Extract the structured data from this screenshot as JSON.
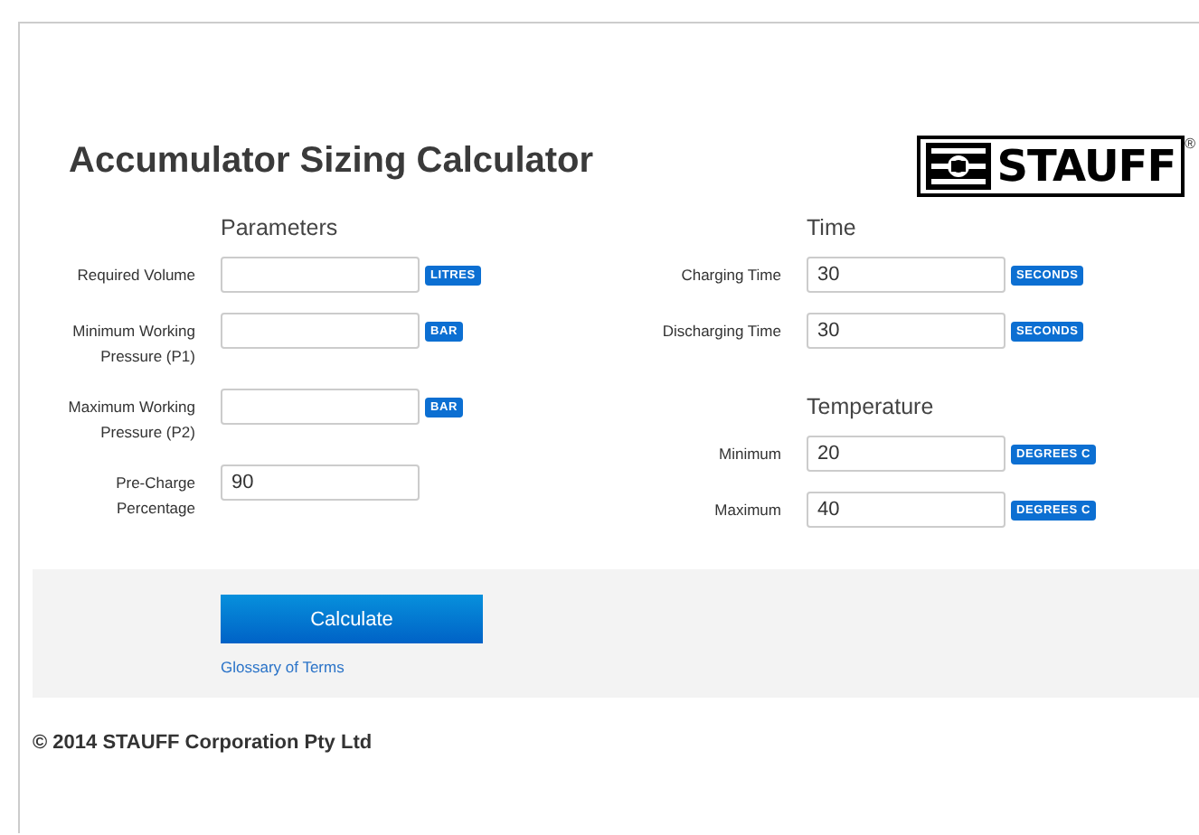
{
  "title": "Accumulator Sizing Calculator",
  "logo": {
    "text": "STAUFF",
    "mark": "®"
  },
  "left_column": [
    {
      "heading": "Parameters",
      "fields": [
        {
          "label": "Required Volume",
          "unit": "LITRES"
        },
        {
          "label": "Minimum Working Pressure (P1)",
          "unit": "BAR"
        },
        {
          "label": "Maximum Working Pressure (P2)",
          "unit": "BAR"
        },
        {
          "label": "Pre-Charge Percentage",
          "value": "90"
        }
      ]
    }
  ],
  "right_column": [
    {
      "heading": "Time",
      "fields": [
        {
          "label": "Charging Time",
          "value": "30",
          "unit": "SECONDS"
        },
        {
          "label": "Discharging Time",
          "value": "30",
          "unit": "SECONDS"
        }
      ]
    },
    {
      "heading": "Temperature",
      "fields": [
        {
          "label": "Minimum",
          "value": "20",
          "unit": "DEGREES C"
        },
        {
          "label": "Maximum",
          "value": "40",
          "unit": "DEGREES C"
        }
      ]
    }
  ],
  "button": "Calculate",
  "link": "Glossary of Terms",
  "footer": "© 2014 STAUFF Corporation Pty Ltd"
}
